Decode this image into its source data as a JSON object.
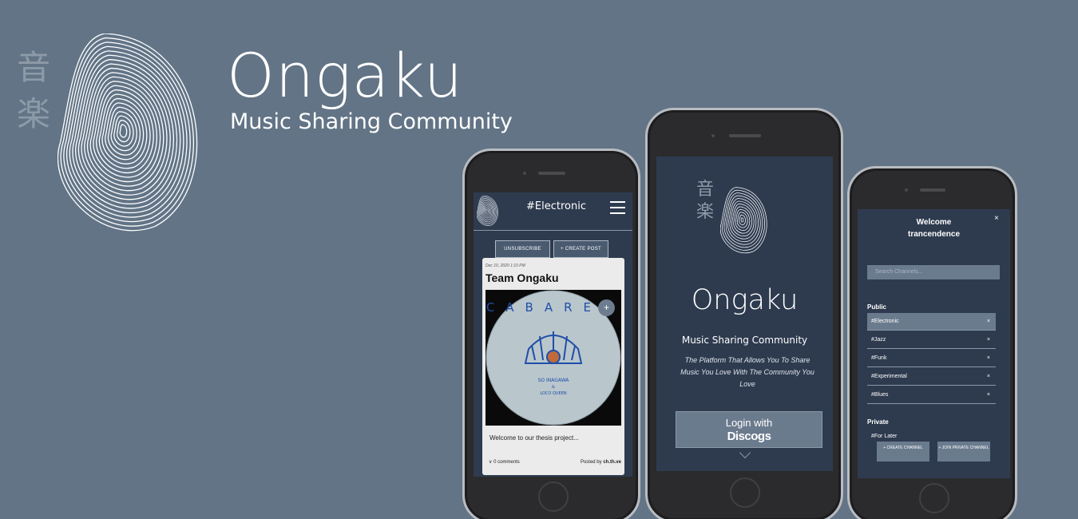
{
  "hero": {
    "kanji_top": "音",
    "kanji_bottom": "楽",
    "title": "Ongaku",
    "subtitle": "Music Sharing Community"
  },
  "phone_feed": {
    "channel": "#Electronic",
    "unsubscribe_label": "UNSUBSCRIBE",
    "create_post_label": "+ CREATE POST",
    "post": {
      "date": "Dec 10, 2020 1:10 PM",
      "author": "Team Ongaku",
      "album_text": "CABARET",
      "album_artist": "SO INAGAWA",
      "album_and": "&",
      "album_artist2": "LOCO QUEEN",
      "text": "Welcome to our thesis project...",
      "comments": "0 comments",
      "posted_by_label": "Posted by",
      "posted_by_user": "ch.th.ve"
    }
  },
  "phone_login": {
    "kanji_top": "音",
    "kanji_bottom": "楽",
    "title": "Ongaku",
    "subtitle": "Music Sharing Community",
    "tagline": "The Platform That Allows You To Share Music You Love With The Community You Love",
    "login_label": "Login with",
    "login_brand": "Discogs"
  },
  "phone_menu": {
    "welcome": "Welcome",
    "username": "trancendence",
    "close_glyph": "×",
    "search_placeholder": "Search Channels...",
    "public_label": "Public",
    "public_channels": [
      {
        "name": "#Electronic",
        "x": "×"
      },
      {
        "name": "#Jazz",
        "x": "×"
      },
      {
        "name": "#Funk",
        "x": "×"
      },
      {
        "name": "#Experimental",
        "x": "×"
      },
      {
        "name": "#Blues",
        "x": "×"
      }
    ],
    "private_label": "Private",
    "private_channels": [
      "#For Later"
    ],
    "create_channel_label": "+ CREATE CHANNEL",
    "join_private_label": "+ JOIN PRIVATE CHANNEL"
  },
  "colors": {
    "background": "#627486",
    "screen": "#2e3b4f",
    "accent": "#6b7b8e"
  }
}
